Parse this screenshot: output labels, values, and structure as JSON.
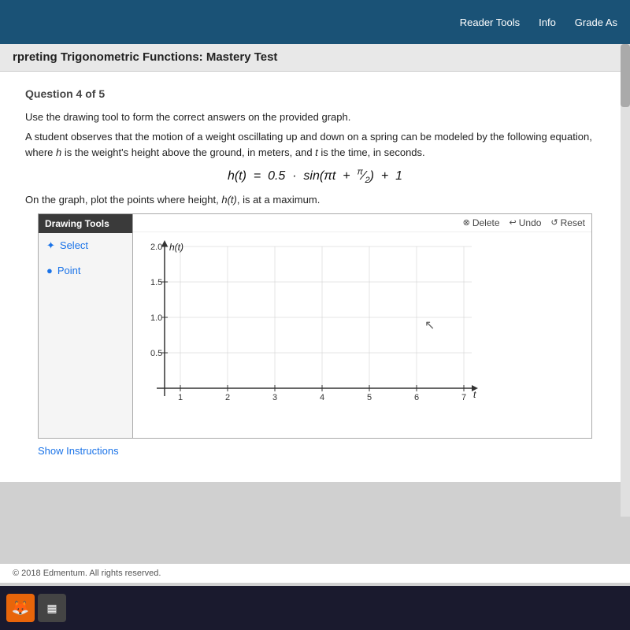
{
  "topbar": {
    "reader_tools_label": "Reader Tools",
    "info_label": "Info",
    "grade_as_label": "Grade As"
  },
  "page_title": {
    "title": "rpreting Trigonometric Functions: Mastery Test"
  },
  "question": {
    "header": "Question 4 of 5",
    "instruction": "Use the drawing tool to form the correct answers on the provided graph.",
    "problem_part1": "A student observes that the motion of a weight oscillating up and down on a spring can be modeled by the following equation, where",
    "h_italic": "h",
    "problem_part2": "is",
    "problem_part3": "the weight's height above the ground, in meters, and",
    "t_italic": "t",
    "problem_part4": "is the time, in seconds.",
    "equation": "h(t)  =  0.5  ·  sin(πt  +  π/2)  +  1",
    "plot_instruction": "On the graph, plot the points where height, h(t), is at a maximum."
  },
  "drawing_tools": {
    "header": "Drawing Tools",
    "select_label": "Select",
    "point_label": "Point"
  },
  "graph_controls": {
    "delete_label": "Delete",
    "undo_label": "Undo",
    "reset_label": "Reset"
  },
  "graph": {
    "y_label": "h(t)",
    "x_label": "t",
    "y_values": [
      "2.0",
      "1.5",
      "1.0",
      "0.5"
    ],
    "x_values": [
      "1",
      "2",
      "3",
      "4",
      "5",
      "6",
      "7"
    ]
  },
  "show_instructions": "Show Instructions",
  "footer": "© 2018 Edmentum. All rights reserved.",
  "icons": {
    "select_icon": "✦",
    "point_icon": "●",
    "delete_icon": "⊗",
    "undo_icon": "↩",
    "reset_icon": "↺"
  }
}
